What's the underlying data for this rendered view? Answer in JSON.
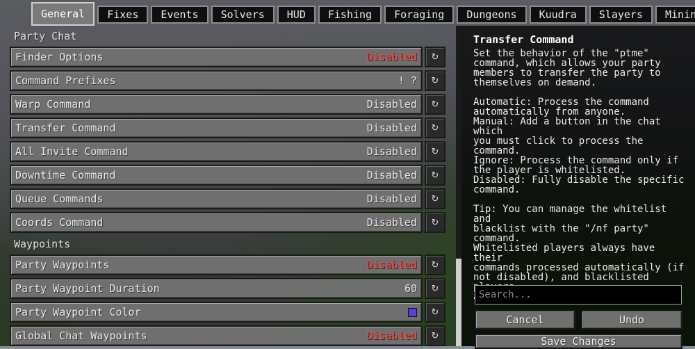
{
  "tabs": [
    "General",
    "Fixes",
    "Events",
    "Solvers",
    "HUD",
    "Fishing",
    "Foraging",
    "Dungeons",
    "Kuudra",
    "Slayers",
    "Mining"
  ],
  "active_tab": "General",
  "sections": {
    "party_chat": "Party Chat",
    "waypoints": "Waypoints"
  },
  "settings": {
    "finder_options": {
      "label": "Finder Options",
      "value": "Disabled"
    },
    "command_prefixes": {
      "label": "Command Prefixes",
      "value": "! ?"
    },
    "warp_command": {
      "label": "Warp Command",
      "value": "Disabled"
    },
    "transfer_command": {
      "label": "Transfer Command",
      "value": "Disabled"
    },
    "all_invite_command": {
      "label": "All Invite Command",
      "value": "Disabled"
    },
    "downtime_command": {
      "label": "Downtime Command",
      "value": "Disabled"
    },
    "queue_commands": {
      "label": "Queue Commands",
      "value": "Disabled"
    },
    "coords_command": {
      "label": "Coords Command",
      "value": "Disabled"
    },
    "party_waypoints": {
      "label": "Party Waypoints",
      "value": "Disabled"
    },
    "party_waypoint_duration": {
      "label": "Party Waypoint Duration",
      "value": "60"
    },
    "party_waypoint_color": {
      "label": "Party Waypoint Color",
      "swatch_color": "#5b3fd9"
    },
    "global_chat_waypoints": {
      "label": "Global Chat Waypoints",
      "value": "Disabled"
    }
  },
  "reset_icon": "↻",
  "description": {
    "title": "Transfer Command",
    "body": "Set the behavior of the \"ptme\"\ncommand, which allows your party\nmembers to transfer the party to\nthemselves on demand.\n\nAutomatic: Process the command\nautomatically from anyone.\nManual: Add a button in the chat which\nyou must click to process the\ncommand.\nIgnore: Process the command only if\nthe player is whitelisted.\nDisabled: Fully disable the specific\ncommand.\n\nTip: You can manage the whitelist and\nblacklist with the \"/nf party\" command.\nWhitelisted players always have their\ncommands processed automatically (if\nnot disabled), and blacklisted players\nalways have their commands ignored."
  },
  "search": {
    "placeholder": "Search..."
  },
  "buttons": {
    "cancel": "Cancel",
    "undo": "Undo",
    "save": "Save Changes"
  },
  "colors": {
    "disabled_red": "#ff4a4a",
    "setting_bg": "#6f6f6f",
    "panel_bg": "#000000"
  }
}
